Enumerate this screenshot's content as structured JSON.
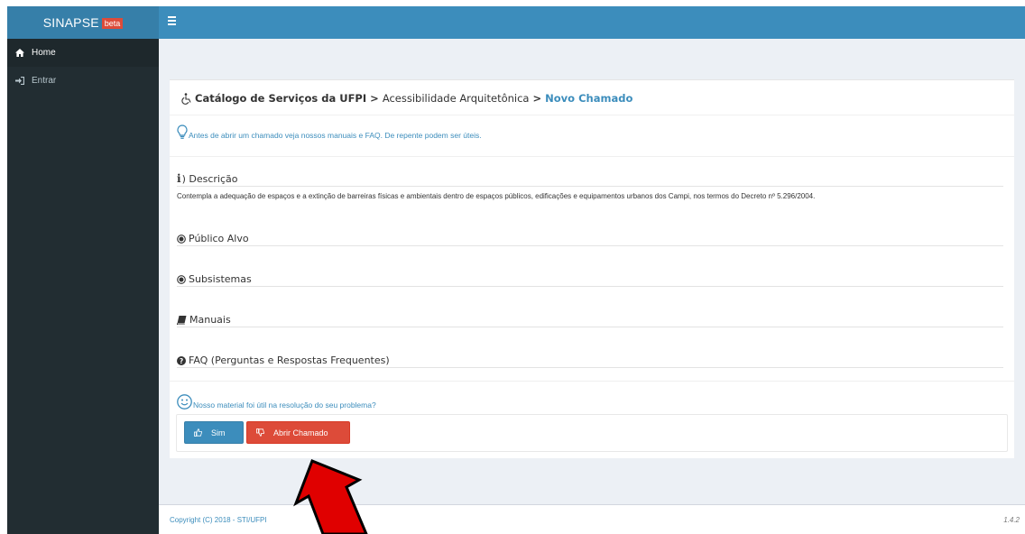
{
  "app": {
    "brand": "SINAPSE",
    "badge": "beta"
  },
  "sidebar": {
    "items": [
      {
        "label": "Home",
        "icon": "home-icon",
        "active": true
      },
      {
        "label": "Entrar",
        "icon": "sign-in-icon",
        "active": false
      }
    ]
  },
  "breadcrumb": {
    "part1": "Catálogo de Serviços da UFPI",
    "sep1": ">",
    "part2": "Acessibilidade Arquitetônica",
    "sep2": ">",
    "current": "Novo Chamado"
  },
  "tip": "Antes de abrir um chamado veja nossos manuais e FAQ. De repente podem ser úteis.",
  "sections": {
    "descricao": {
      "icon_text": "i",
      "label": ") Descrição"
    },
    "descricao_text": "Contempla a adequação de espaços e a extinção de barreiras físicas e ambientais dentro de espaços públicos, edificações e equipamentos urbanos dos Campi, nos termos do Decreto nº 5.296/2004.",
    "publico": "Público Alvo",
    "subsistemas": "Subsistemas",
    "manuais": "Manuais",
    "faq": "FAQ (Perguntas e Respostas Frequentes)"
  },
  "feedback": {
    "question": "Nosso material foi útil na resolução do seu problema?",
    "yes_label": "Sim",
    "open_label": "Abrir Chamado"
  },
  "footer": {
    "copyright": "Copyright (C) 2018 - STI/UFPI",
    "version": "1.4.2"
  },
  "colors": {
    "header": "#3c8dbc",
    "logo_bg": "#367fa9",
    "sidebar": "#222d32",
    "danger": "#dd4b39",
    "annotation_arrow": "#e00000"
  }
}
